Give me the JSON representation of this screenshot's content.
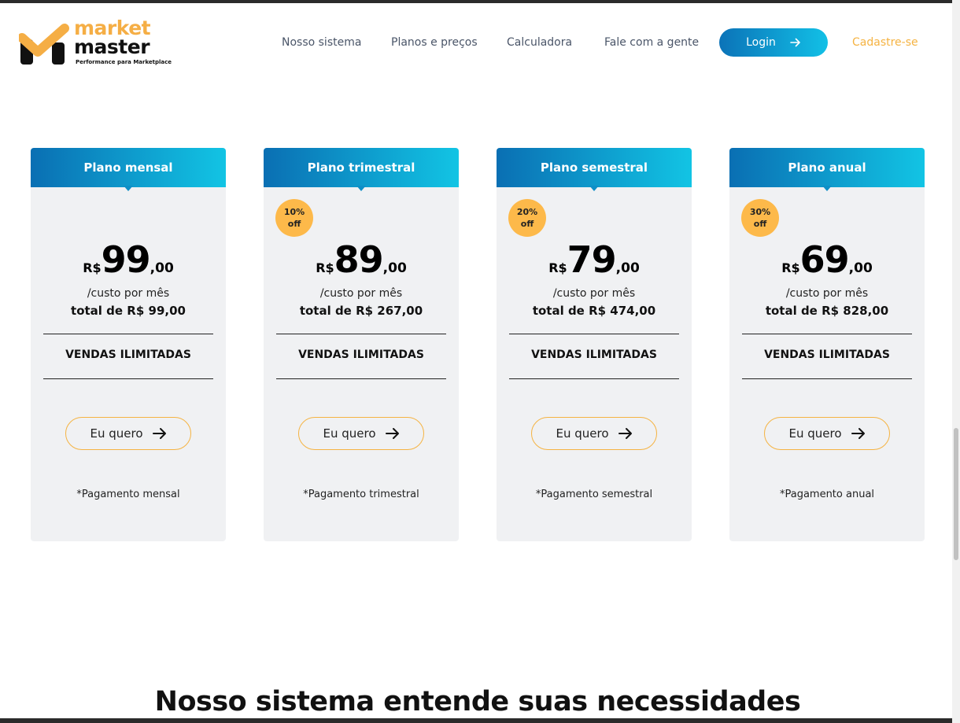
{
  "header": {
    "logo": {
      "word1": "market",
      "word2": "master",
      "tagline": "Performance para Marketplace"
    },
    "nav": [
      "Nosso sistema",
      "Planos e preços",
      "Calculadora",
      "Fale com a gente"
    ],
    "login_label": "Login",
    "login_icon": "arrow-right-icon",
    "signup_label": "Cadastre-se"
  },
  "plans": [
    {
      "title": "Plano mensal",
      "badge": "",
      "badge_off": "",
      "currency": "R$",
      "amount": "99",
      "cents": ",00",
      "per": "/custo por mês",
      "total": "total de R$ 99,00",
      "feature": "VENDAS ILIMITADAS",
      "cta": "Eu quero",
      "note": "*Pagamento mensal"
    },
    {
      "title": "Plano trimestral",
      "badge": "10%",
      "badge_off": "off",
      "currency": "R$",
      "amount": "89",
      "cents": ",00",
      "per": "/custo por mês",
      "total": "total de R$ 267,00",
      "feature": "VENDAS ILIMITADAS",
      "cta": "Eu quero",
      "note": "*Pagamento trimestral"
    },
    {
      "title": "Plano semestral",
      "badge": "20%",
      "badge_off": "off",
      "currency": "R$",
      "amount": "79",
      "cents": ",00",
      "per": "/custo por mês",
      "total": "total de R$ 474,00",
      "feature": "VENDAS ILIMITADAS",
      "cta": "Eu quero",
      "note": "*Pagamento semestral"
    },
    {
      "title": "Plano anual",
      "badge": "30%",
      "badge_off": "off",
      "currency": "R$",
      "amount": "69",
      "cents": ",00",
      "per": "/custo por mês",
      "total": "total de R$ 828,00",
      "feature": "VENDAS ILIMITADAS",
      "cta": "Eu quero",
      "note": "*Pagamento anual"
    }
  ],
  "section_title": "Nosso sistema entende suas necessidades",
  "colors": {
    "accent_blue": "#0a6fb3",
    "accent_cyan": "#12c4e4",
    "accent_orange": "#f5b342"
  }
}
